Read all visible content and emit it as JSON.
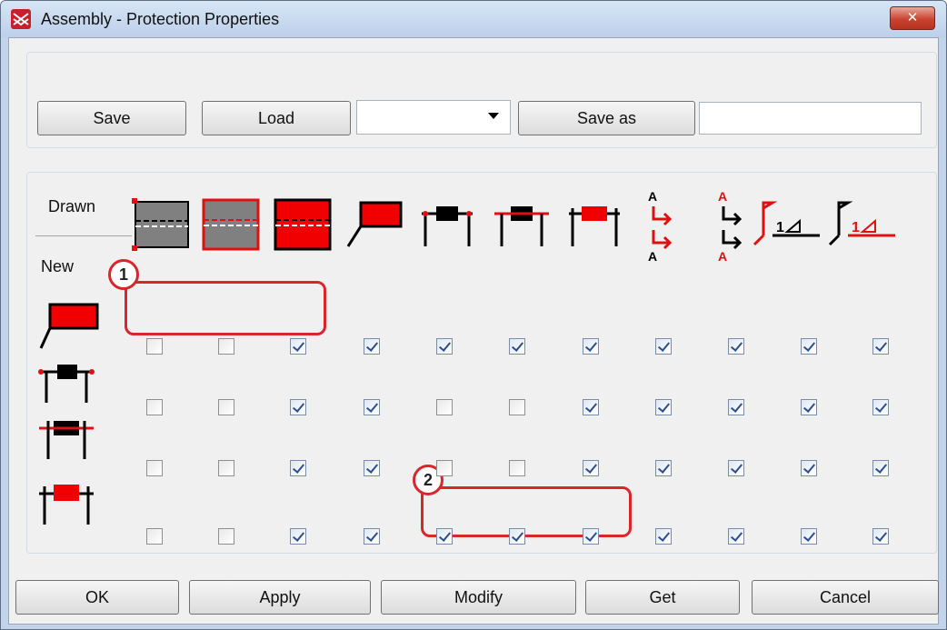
{
  "window": {
    "title": "Assembly - Protection Properties",
    "close_label": "✕"
  },
  "toolbar": {
    "save_label": "Save",
    "load_label": "Load",
    "combo_value": "",
    "save_as_label": "Save as",
    "save_as_value": ""
  },
  "grid": {
    "drawn_label": "Drawn",
    "new_label": "New",
    "column_icons": [
      "protection-gray-dashed-icon",
      "protection-gray-red-outline-icon",
      "protection-red-filled-icon",
      "protection-flag-red-icon",
      "protection-black-post-icon",
      "protection-red-line-post-icon",
      "protection-red-block-post-icon",
      "section-arrow-black-icon",
      "section-arrow-red-icon",
      "level-mark-red-icon",
      "level-mark-black-icon"
    ],
    "row_icons": [
      "protection-flag-red-icon",
      "protection-black-post-icon",
      "protection-red-line-post-icon",
      "protection-red-block-post-icon"
    ],
    "checks": [
      [
        false,
        false,
        true,
        true,
        true,
        true,
        true,
        true,
        true,
        true,
        true
      ],
      [
        false,
        false,
        true,
        true,
        false,
        false,
        true,
        true,
        true,
        true,
        true
      ],
      [
        false,
        false,
        true,
        true,
        false,
        false,
        true,
        true,
        true,
        true,
        true
      ],
      [
        false,
        false,
        true,
        true,
        true,
        true,
        true,
        true,
        true,
        true,
        true
      ]
    ]
  },
  "callouts": [
    {
      "number": "1"
    },
    {
      "number": "2"
    }
  ],
  "footer": {
    "ok_label": "OK",
    "apply_label": "Apply",
    "modify_label": "Modify",
    "get_label": "Get",
    "cancel_label": "Cancel"
  }
}
